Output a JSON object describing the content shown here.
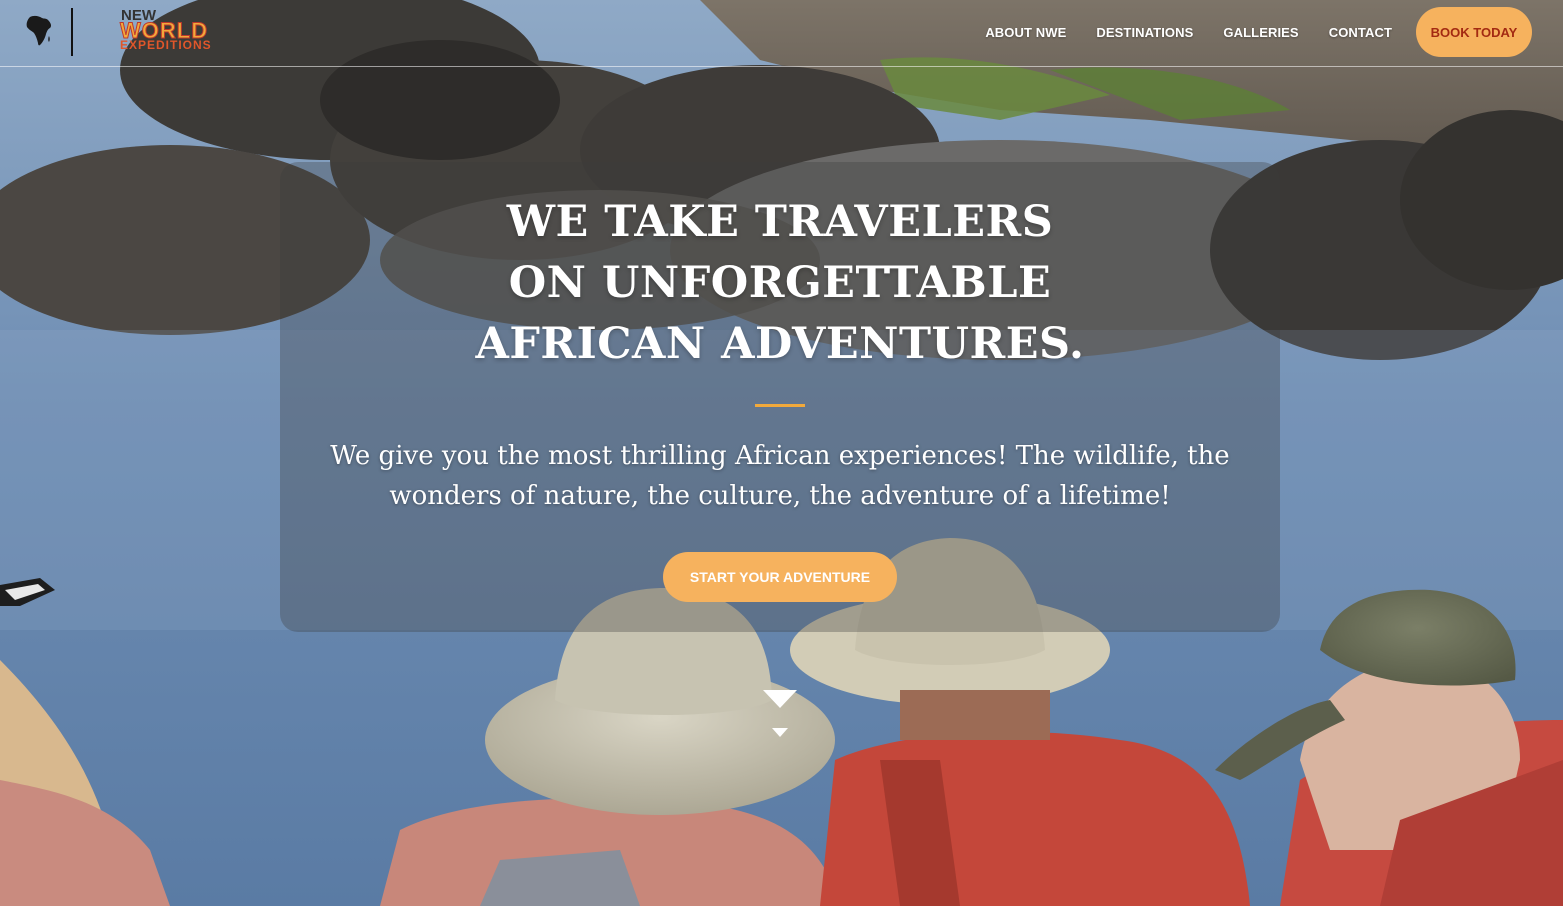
{
  "brand": {
    "logo_line1": "NEW",
    "logo_line2": "WORLD",
    "logo_line3": "EXPEDITIONS"
  },
  "nav": {
    "links": [
      {
        "label": "ABOUT NWE"
      },
      {
        "label": "DESTINATIONS"
      },
      {
        "label": "GALLERIES"
      },
      {
        "label": "CONTACT"
      }
    ],
    "cta_label": "BOOK TODAY"
  },
  "hero": {
    "title": "WE TAKE TRAVELERS ON UNFORGETTABLE AFRICAN ADVENTURES.",
    "subtitle": "We give you the most thrilling African experiences! The wildlife, the wonders of nature, the culture, the adventure of a lifetime!",
    "cta_label": "START YOUR ADVENTURE"
  },
  "icons": {
    "brand_mark": "africa-icon",
    "scroll": "chevron-down-icon"
  },
  "colors": {
    "accent": "#f6b25e",
    "book_text": "#a32a12",
    "rule": "#f2a93b"
  }
}
